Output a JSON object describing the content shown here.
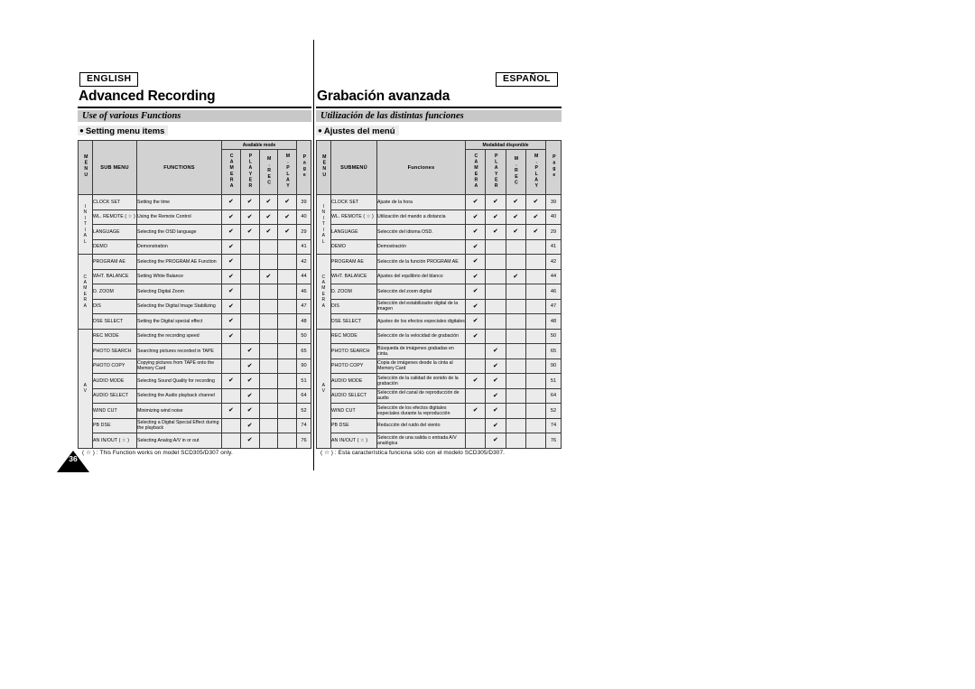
{
  "page_number": "36",
  "en": {
    "lang_tag": "ENGLISH",
    "section_title": "Advanced Recording",
    "grey_bar": "Use of various Functions",
    "bullet": "Setting menu items",
    "table": {
      "available_mode_label": "Available mode",
      "headers": {
        "menu": "MENU",
        "sub_menu": "SUB MENU",
        "functions": "FUNCTIONS",
        "mode_camera": "CAMERA",
        "mode_player": "PLAYER",
        "mode_mrec": "M.REC",
        "mode_mplay": "M.PLAY",
        "page": "Page"
      },
      "groups": [
        {
          "label": "INITIAL",
          "rows": [
            {
              "sub_menu": "CLOCK SET",
              "function": "Setting the time",
              "camera": true,
              "player": true,
              "mrec": true,
              "mplay": true,
              "page": "39"
            },
            {
              "sub_menu": "WL. REMOTE ( ☆ )",
              "function": "Using the Remote Control",
              "camera": true,
              "player": true,
              "mrec": true,
              "mplay": true,
              "page": "40"
            },
            {
              "sub_menu": "LANGUAGE",
              "function": "Selecting the OSD language",
              "camera": true,
              "player": true,
              "mrec": true,
              "mplay": true,
              "page": "29"
            },
            {
              "sub_menu": "DEMO",
              "function": "Demonstration",
              "camera": true,
              "player": false,
              "mrec": false,
              "mplay": false,
              "page": "41"
            }
          ]
        },
        {
          "label": "CAMERA",
          "rows": [
            {
              "sub_menu": "PROGRAM AE",
              "function": "Selecting the PROGRAM AE Function",
              "camera": true,
              "player": false,
              "mrec": false,
              "mplay": false,
              "page": "42"
            },
            {
              "sub_menu": "WHT. BALANCE",
              "function": "Setting White Balance",
              "camera": true,
              "player": false,
              "mrec": true,
              "mplay": false,
              "page": "44"
            },
            {
              "sub_menu": "D. ZOOM",
              "function": "Selecting Digital Zoom",
              "camera": true,
              "player": false,
              "mrec": false,
              "mplay": false,
              "page": "46"
            },
            {
              "sub_menu": "DIS",
              "function": "Selecting the Digital Image Stabilizing",
              "camera": true,
              "player": false,
              "mrec": false,
              "mplay": false,
              "page": "47"
            },
            {
              "sub_menu": "DSE SELECT",
              "function": "Setting the Digital special effect",
              "camera": true,
              "player": false,
              "mrec": false,
              "mplay": false,
              "page": "48"
            }
          ]
        },
        {
          "label": "A V",
          "rows": [
            {
              "sub_menu": "REC MODE",
              "function": "Selecting the recording speed",
              "camera": true,
              "player": false,
              "mrec": false,
              "mplay": false,
              "page": "50"
            },
            {
              "sub_menu": "PHOTO SEARCH",
              "function": "Searching pictures recorded in TAPE",
              "camera": false,
              "player": true,
              "mrec": false,
              "mplay": false,
              "page": "65"
            },
            {
              "sub_menu": "PHOTO COPY",
              "function": "Copying pictures from TAPE onto the Memory Card",
              "camera": false,
              "player": true,
              "mrec": false,
              "mplay": false,
              "page": "90"
            },
            {
              "sub_menu": "AUDIO MODE",
              "function": "Selecting Sound Quality for recording",
              "camera": true,
              "player": true,
              "mrec": false,
              "mplay": false,
              "page": "51"
            },
            {
              "sub_menu": "AUDIO SELECT",
              "function": "Selecting the Audio playback channel",
              "camera": false,
              "player": true,
              "mrec": false,
              "mplay": false,
              "page": "64"
            },
            {
              "sub_menu": "WIND CUT",
              "function": "Minimizing wind noise",
              "camera": true,
              "player": true,
              "mrec": false,
              "mplay": false,
              "page": "52"
            },
            {
              "sub_menu": "PB DSE",
              "function": "Selecting a Digital Special Effect during the playback",
              "camera": false,
              "player": true,
              "mrec": false,
              "mplay": false,
              "page": "74"
            },
            {
              "sub_menu": "AN IN/OUT ( ☆ )",
              "function": "Selecting Analog A/V in or out",
              "camera": false,
              "player": true,
              "mrec": false,
              "mplay": false,
              "page": "76"
            }
          ]
        }
      ]
    },
    "footnote": "( ☆ ) : This Function works on model SCD305/D307 only."
  },
  "es": {
    "lang_tag": "ESPAÑOL",
    "section_title": "Grabación avanzada",
    "grey_bar": "Utilización de las distintas funciones",
    "bullet": "Ajustes del menú",
    "table": {
      "available_mode_label": "Modalidad disponible",
      "headers": {
        "menu": "MENU",
        "sub_menu": "SUBMENÚ",
        "functions": "Funciones",
        "mode_camera": "CAMERA",
        "mode_player": "PLAYER",
        "mode_mrec": "M.REC",
        "mode_mplay": "M.PLAY",
        "page": "Page"
      },
      "groups": [
        {
          "label": "INITIAL",
          "rows": [
            {
              "sub_menu": "CLOCK SET",
              "function": "Ajuste de la hora",
              "camera": true,
              "player": true,
              "mrec": true,
              "mplay": true,
              "page": "39"
            },
            {
              "sub_menu": "WL. REMOTE ( ☆ )",
              "function": "Utilización del mando a distancia",
              "camera": true,
              "player": true,
              "mrec": true,
              "mplay": true,
              "page": "40"
            },
            {
              "sub_menu": "LANGUAGE",
              "function": "Selección del idioma OSD.",
              "camera": true,
              "player": true,
              "mrec": true,
              "mplay": true,
              "page": "29"
            },
            {
              "sub_menu": "DEMO",
              "function": "Demostración",
              "camera": true,
              "player": false,
              "mrec": false,
              "mplay": false,
              "page": "41"
            }
          ]
        },
        {
          "label": "CAMERA",
          "rows": [
            {
              "sub_menu": "PROGRAM AE",
              "function": "Selección de la función PROGRAM AE",
              "camera": true,
              "player": false,
              "mrec": false,
              "mplay": false,
              "page": "42"
            },
            {
              "sub_menu": "WHT. BALANCE",
              "function": "Ajustes del equilibrio del blanco",
              "camera": true,
              "player": false,
              "mrec": true,
              "mplay": false,
              "page": "44"
            },
            {
              "sub_menu": "D. ZOOM",
              "function": "Selección del zoom digital",
              "camera": true,
              "player": false,
              "mrec": false,
              "mplay": false,
              "page": "46"
            },
            {
              "sub_menu": "DIS",
              "function": "Selección del estabilizador digital de la imagen",
              "camera": true,
              "player": false,
              "mrec": false,
              "mplay": false,
              "page": "47"
            },
            {
              "sub_menu": "DSE SELECT",
              "function": "Ajustes de los efectos especiales digitales",
              "camera": true,
              "player": false,
              "mrec": false,
              "mplay": false,
              "page": "48"
            }
          ]
        },
        {
          "label": "A V",
          "rows": [
            {
              "sub_menu": "REC MODE",
              "function": "Selección de la velocidad de grabación",
              "camera": true,
              "player": false,
              "mrec": false,
              "mplay": false,
              "page": "50"
            },
            {
              "sub_menu": "PHOTO SEARCH",
              "function": "Búsqueda de imágenes grabadas en cinta.",
              "camera": false,
              "player": true,
              "mrec": false,
              "mplay": false,
              "page": "65"
            },
            {
              "sub_menu": "PHOTO COPY",
              "function": "Copia de imágenes desde la cinta al Memory Card",
              "camera": false,
              "player": true,
              "mrec": false,
              "mplay": false,
              "page": "90"
            },
            {
              "sub_menu": "AUDIO MODE",
              "function": "Selección de la calidad de sonido de la grabación",
              "camera": true,
              "player": true,
              "mrec": false,
              "mplay": false,
              "page": "51"
            },
            {
              "sub_menu": "AUDIO SELECT",
              "function": "Selección del canal de reproducción de audio",
              "camera": false,
              "player": true,
              "mrec": false,
              "mplay": false,
              "page": "64"
            },
            {
              "sub_menu": "WIND CUT",
              "function": "Selección de los efectos digitales especiales durante la reproducción",
              "camera": true,
              "player": true,
              "mrec": false,
              "mplay": false,
              "page": "52"
            },
            {
              "sub_menu": "PB DSE",
              "function": "Reducción del ruido del viento",
              "camera": false,
              "player": true,
              "mrec": false,
              "mplay": false,
              "page": "74"
            },
            {
              "sub_menu": "AN IN/OUT ( ☆ )",
              "function": "Selección de una salida o entrada A/V analógica",
              "camera": false,
              "player": true,
              "mrec": false,
              "mplay": false,
              "page": "76"
            }
          ]
        }
      ]
    },
    "footnote": "( ☆ ) : Esta característica funciona sólo con el modelo SCD305/D307."
  },
  "checkmark_glyph": "✔"
}
